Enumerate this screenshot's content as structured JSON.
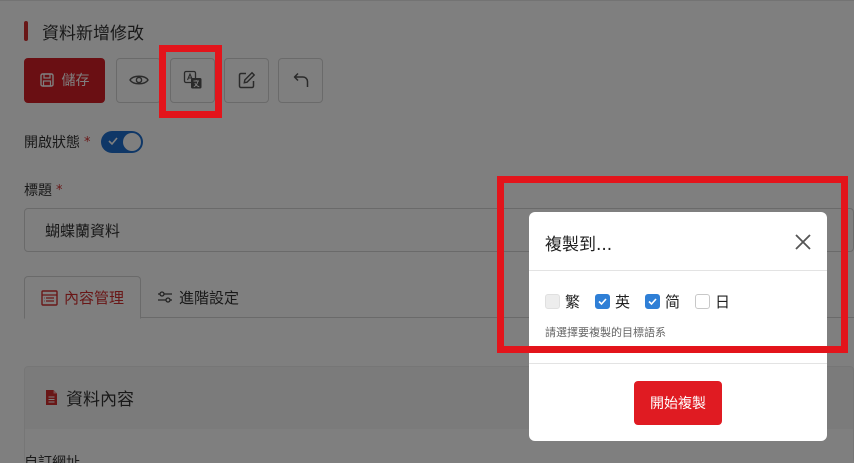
{
  "header": {
    "section_title": "資料新增修改"
  },
  "toolbar": {
    "save_label": "儲存",
    "buttons": [
      "eye-icon",
      "translate-icon",
      "edit-icon",
      "undo-icon"
    ]
  },
  "form": {
    "status_label": "開啟狀態",
    "status_on": true,
    "required_mark": "*",
    "title_label": "標題",
    "title_value": "蝴蝶蘭資料"
  },
  "tabs": [
    {
      "label": "內容管理",
      "active": true,
      "icon": "list-icon"
    },
    {
      "label": "進階設定",
      "active": false,
      "icon": "sliders-icon"
    }
  ],
  "content": {
    "card_title": "資料內容",
    "field_label": "自訂網址"
  },
  "modal": {
    "title": "複製到...",
    "options": [
      {
        "label": "繁",
        "checked": false,
        "disabled": true
      },
      {
        "label": "英",
        "checked": true,
        "disabled": false
      },
      {
        "label": "简",
        "checked": true,
        "disabled": false
      },
      {
        "label": "日",
        "checked": false,
        "disabled": false
      }
    ],
    "hint": "請選擇要複製的目標語系",
    "start_label": "開始複製"
  },
  "colors": {
    "brand_red": "#d41f26",
    "toggle_blue": "#1f6fcf",
    "checkbox_blue": "#2f7fd6",
    "highlight_red": "#e3141b"
  }
}
